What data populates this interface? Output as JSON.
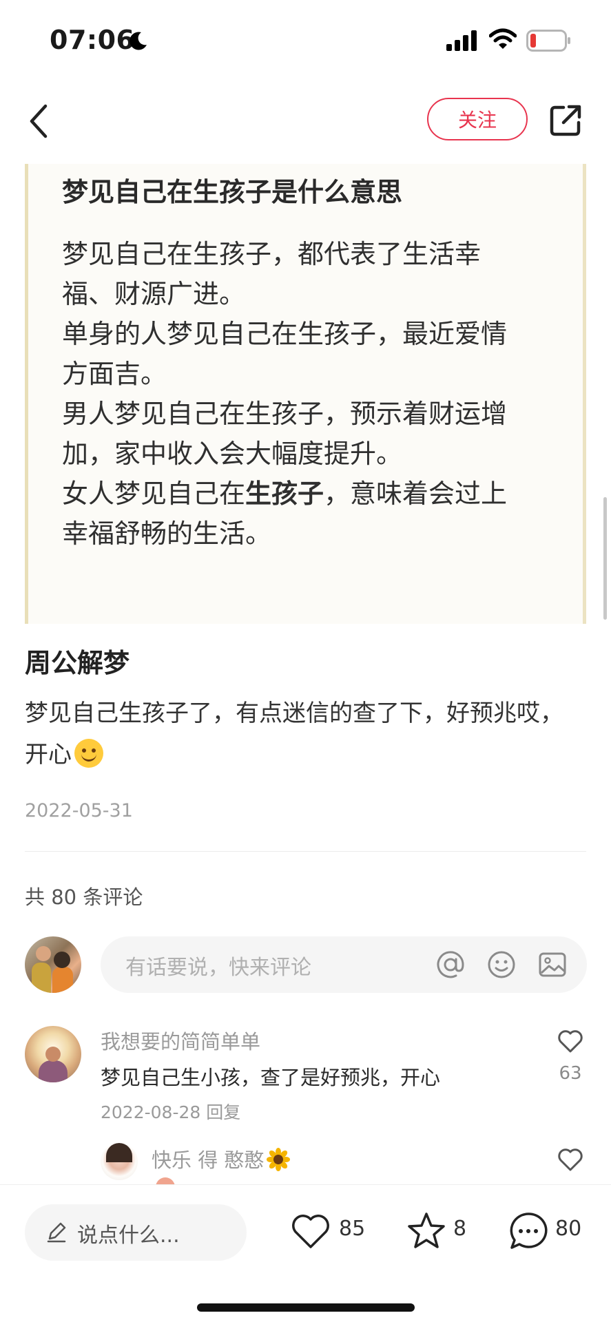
{
  "status_bar": {
    "time": "07:06",
    "icons": [
      "moon-icon",
      "cellular-signal-icon",
      "wifi-icon",
      "battery-low-icon"
    ],
    "battery_color": "#e53935"
  },
  "nav": {
    "follow_label": "关注",
    "accent_color": "#e8344e",
    "icons": [
      "back-arrow-icon",
      "share-icon"
    ]
  },
  "post_image": {
    "title": "梦见自己在生孩子是什么意思",
    "lines": [
      "梦见自己在生孩子，都代表了生活幸",
      "福、财源广进。",
      "单身的人梦见自己在生孩子，最近爱情",
      "方面吉。",
      "男人梦见自己在生孩子，预示着财运增",
      "加，家中收入会大幅度提升。"
    ],
    "line7_a": "女人梦见自己在",
    "line7_bold": "生孩子",
    "line7_b": "，意味着会过上",
    "line8": "幸福舒畅的生活。"
  },
  "post": {
    "title": "周公解梦",
    "body": "梦见自己生孩子了，有点迷信的查了下，好预兆哎，开心",
    "body_emoji": "smiling-face-emoji",
    "date": "2022-05-31"
  },
  "comments_section": {
    "count_label": "共 80 条评论",
    "input_placeholder": "有话要说，快来评论",
    "input_icons": [
      "at-icon",
      "emoji-icon",
      "image-icon"
    ]
  },
  "comments": [
    {
      "user": "我想要的简简单单",
      "text": "梦见自己生小孩，查了是好预兆，开心",
      "date": "2022-08-28",
      "reply_label": "回复",
      "likes": "63"
    },
    {
      "user": "快乐 得 憨憨",
      "user_emoji": "sunflower-emoji"
    }
  ],
  "bottom_bar": {
    "input_placeholder": "说点什么...",
    "likes": "85",
    "collects": "8",
    "comments": "80",
    "icons": [
      "pencil-icon",
      "heart-icon",
      "star-icon",
      "comment-bubble-icon"
    ]
  }
}
